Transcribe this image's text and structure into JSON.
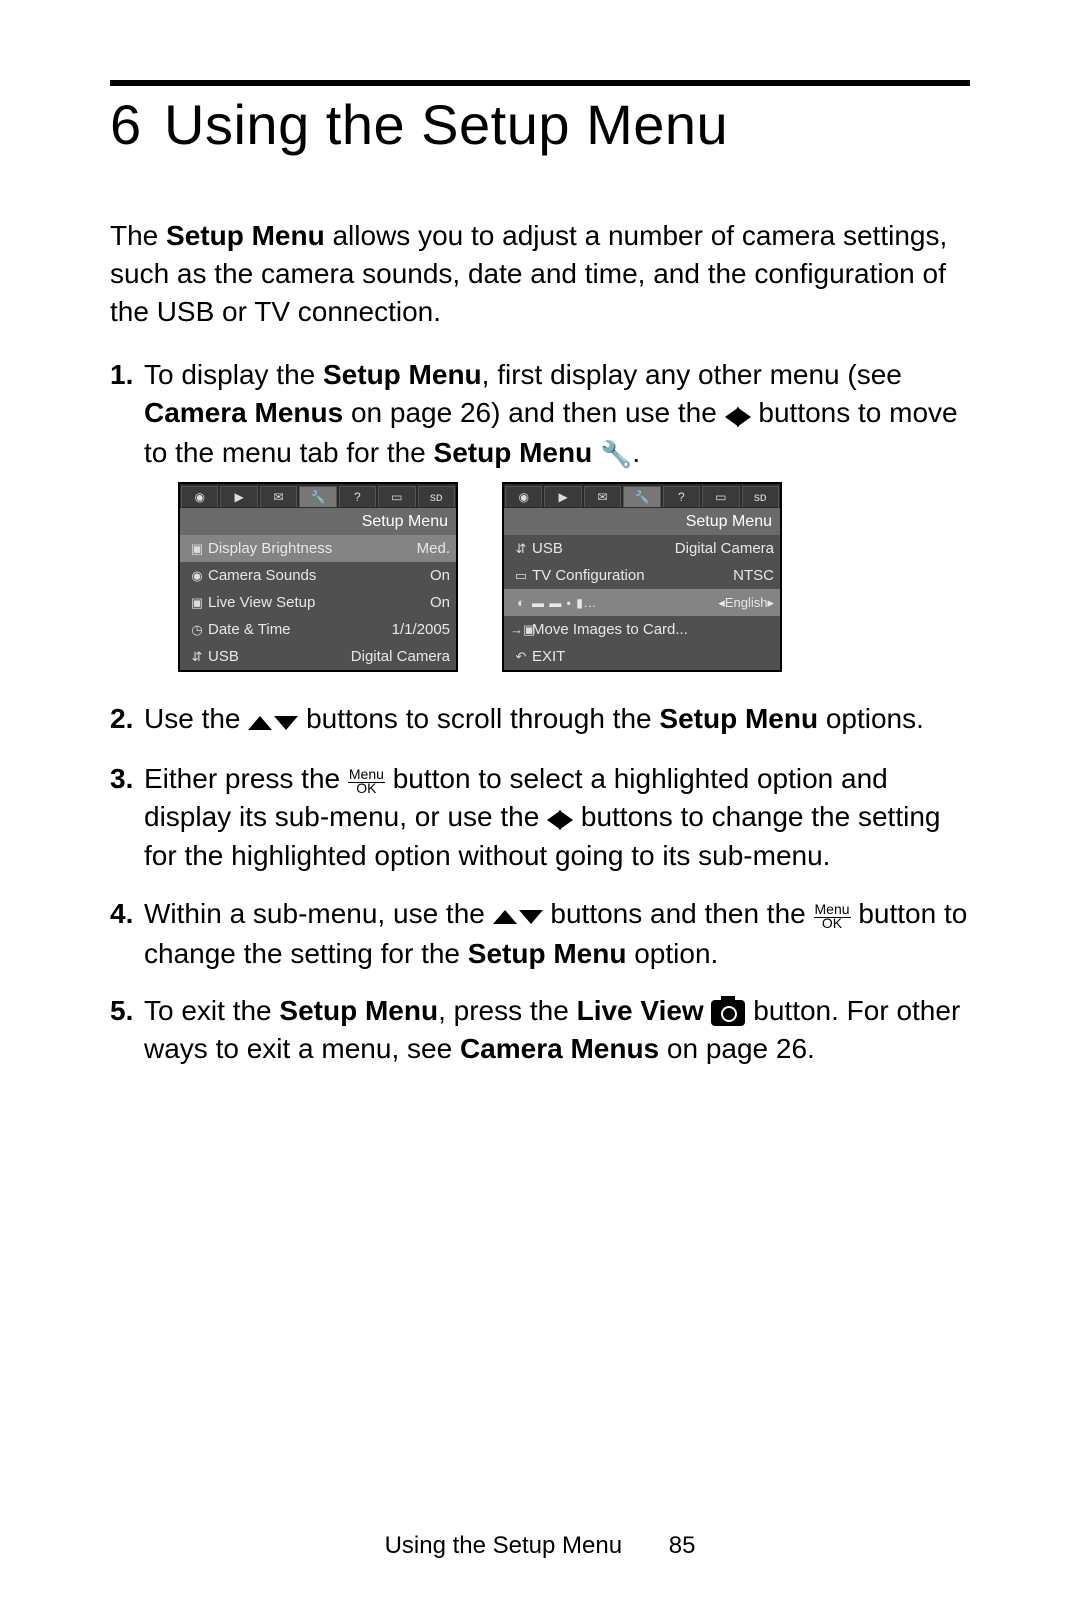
{
  "chapter_number": "6",
  "chapter_title": "Using the Setup Menu",
  "intro_1a": "The ",
  "intro_1b": "Setup Menu",
  "intro_1c": " allows you to adjust a number of camera settings, such as the camera sounds, date and time, and the configuration of the USB or TV connection.",
  "steps": {
    "s1a": "To display the ",
    "s1b": "Setup Menu",
    "s1c": ", first display any other menu (see ",
    "s1d": "Camera Menus",
    "s1e": " on page 26) and then use the ",
    "s1f": " buttons to move to the menu tab for the ",
    "s1g": "Setup Menu",
    "s1h": ".",
    "s2a": "Use the ",
    "s2b": " buttons to scroll through the ",
    "s2c": "Setup Menu",
    "s2d": " options.",
    "s3a": "Either press the ",
    "s3b": " button to select a highlighted option and display its sub-menu, or use the ",
    "s3c": " buttons to change the setting for the highlighted option without going to its sub-menu.",
    "s4a": "Within a sub-menu, use the ",
    "s4b": " buttons and then the ",
    "s4c": " button to change the setting for the ",
    "s4d": "Setup Menu",
    "s4e": " option.",
    "s5a": "To exit the ",
    "s5b": "Setup Menu",
    "s5c": ", press the ",
    "s5d": "Live View",
    "s5e": " button. For other ways to exit a menu, see ",
    "s5f": "Camera Menus",
    "s5g": " on page 26."
  },
  "menuok_top": "Menu",
  "menuok_bot": "OK",
  "screens": {
    "left": {
      "header": "Setup Menu",
      "rows": [
        {
          "icon": "▣",
          "label": "Display Brightness",
          "value": "Med."
        },
        {
          "icon": "◉",
          "label": "Camera Sounds",
          "value": "On"
        },
        {
          "icon": "▣",
          "label": "Live View Setup",
          "value": "On"
        },
        {
          "icon": "◷",
          "label": "Date & Time",
          "value": "1/1/2005"
        },
        {
          "icon": "⇵",
          "label": "USB",
          "value": "Digital Camera"
        }
      ]
    },
    "right": {
      "header": "Setup Menu",
      "rows": [
        {
          "icon": "⇵",
          "label": "USB",
          "value": "Digital Camera"
        },
        {
          "icon": "▭",
          "label": "TV Configuration",
          "value": "NTSC"
        },
        {
          "icon": "◐",
          "label": "",
          "value": "◂English▸",
          "flags": true
        },
        {
          "icon": "→▣",
          "label": "Move Images to Card...",
          "value": ""
        },
        {
          "icon": "↶",
          "label": "EXIT",
          "value": ""
        }
      ]
    }
  },
  "footer_text": "Using the Setup Menu",
  "page_number": "85"
}
